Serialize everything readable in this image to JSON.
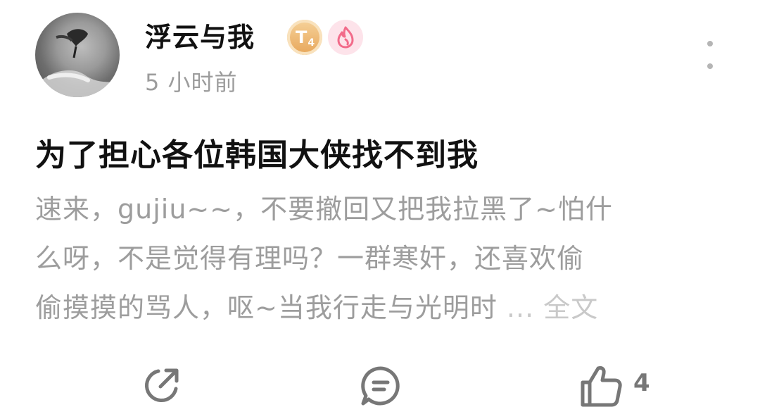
{
  "post": {
    "username": "浮云与我",
    "badge_level": "T",
    "badge_level_num": "4",
    "timestamp": "5 小时前",
    "title": "为了担心各位韩国大侠找不到我",
    "body_lines": [
      "速来，gujiu~~，不要撤回又把我拉黑了~怕什",
      "么呀，不是觉得有理吗？一群寒奸，还喜欢偷",
      "偷摸摸的骂人，呕~当我行走与光明时"
    ],
    "ellipsis": " ...",
    "full_text_label": "全文"
  },
  "actions": {
    "share_icon": "share-icon",
    "comment_icon": "comment-icon",
    "like_icon": "thumbs-up-icon",
    "like_count": "4"
  },
  "colors": {
    "title": "#111111",
    "body": "#9d9d9d",
    "muted": "#c9c9c9",
    "icon": "#777777",
    "badge_gold": "#e7a65a",
    "badge_pink": "#f26b8a"
  }
}
